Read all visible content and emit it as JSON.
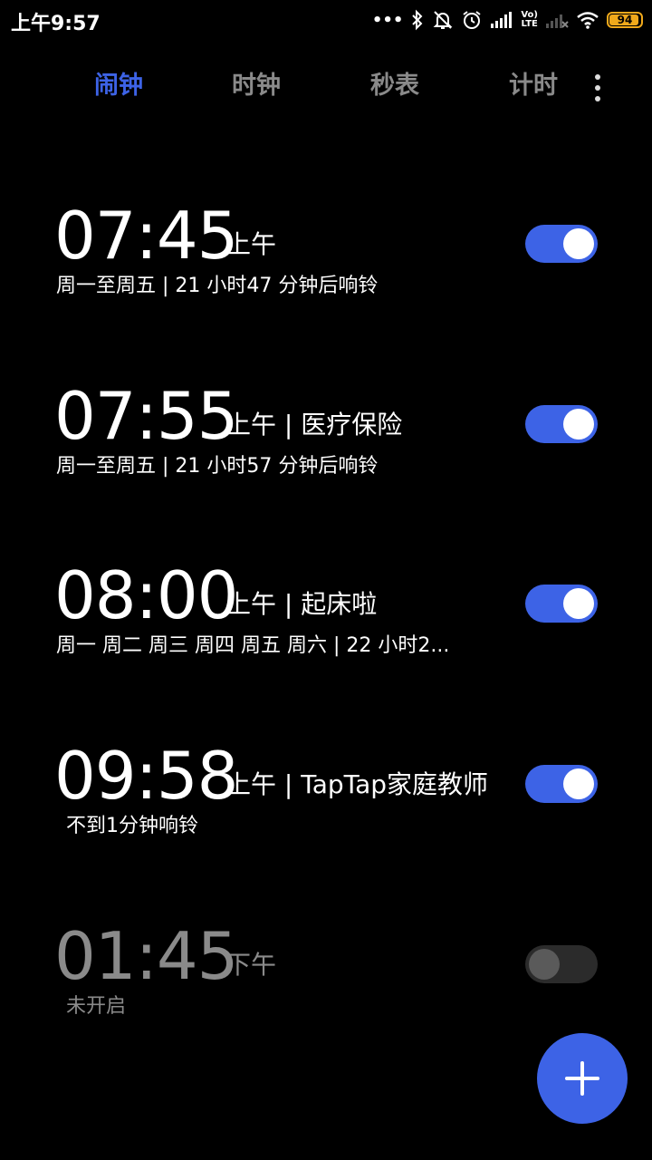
{
  "status_bar": {
    "time": "上午9:57",
    "dots": "•••",
    "lte_label_top": "Vo)",
    "lte_label_bottom": "LTE",
    "battery_level": "94",
    "battery_fraction": 0.94,
    "icons": [
      "bluetooth-icon",
      "bell-off-icon",
      "alarm-clock-icon",
      "signal-icon",
      "volte-icon",
      "signal-no-service-icon",
      "wifi-icon",
      "battery-icon"
    ]
  },
  "tabs": [
    {
      "label": "闹钟",
      "active": true
    },
    {
      "label": "时钟",
      "active": false
    },
    {
      "label": "秒表",
      "active": false
    },
    {
      "label": "计时",
      "active": false
    }
  ],
  "alarms": [
    {
      "time": "07:45",
      "meta": "上午",
      "subtitle": "周一至周五 | 21 小时47 分钟后响铃",
      "enabled": true
    },
    {
      "time": "07:55",
      "meta": "上午 | 医疗保险",
      "subtitle": "周一至周五 | 21 小时57 分钟后响铃",
      "enabled": true
    },
    {
      "time": "08:00",
      "meta": "上午 | 起床啦",
      "subtitle": "周一 周二 周三 周四 周五 周六 | 22 小时2...",
      "enabled": true
    },
    {
      "time": "09:58",
      "meta": "上午 | TapTap家庭教师",
      "subtitle": "不到1分钟响铃",
      "enabled": true
    },
    {
      "time": "01:45",
      "meta": "下午",
      "subtitle": "未开启",
      "enabled": false
    }
  ],
  "colors": {
    "accent": "#3d63e6",
    "background": "#000000",
    "inactive": "#8a8a8a",
    "battery": "#f0a91b"
  },
  "fab_icon": "plus-icon"
}
